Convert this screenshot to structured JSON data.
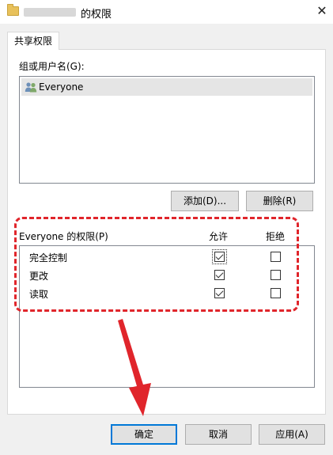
{
  "window": {
    "title_suffix": "的权限",
    "close_glyph": "✕"
  },
  "tabs": [
    {
      "label": "共享权限"
    }
  ],
  "group": {
    "label": "组或用户名(G):",
    "items": [
      {
        "name": "Everyone",
        "icon": "users-icon",
        "selected": true
      }
    ]
  },
  "buttons": {
    "add": "添加(D)...",
    "remove": "删除(R)",
    "ok": "确定",
    "cancel": "取消",
    "apply": "应用(A)"
  },
  "permissions": {
    "header": "Everyone 的权限(P)",
    "allow_label": "允许",
    "deny_label": "拒绝",
    "rows": [
      {
        "label": "完全控制",
        "allow": true,
        "deny": false
      },
      {
        "label": "更改",
        "allow": true,
        "deny": false
      },
      {
        "label": "读取",
        "allow": true,
        "deny": false
      }
    ]
  },
  "annotation": {
    "highlight_color": "#e0252b"
  }
}
